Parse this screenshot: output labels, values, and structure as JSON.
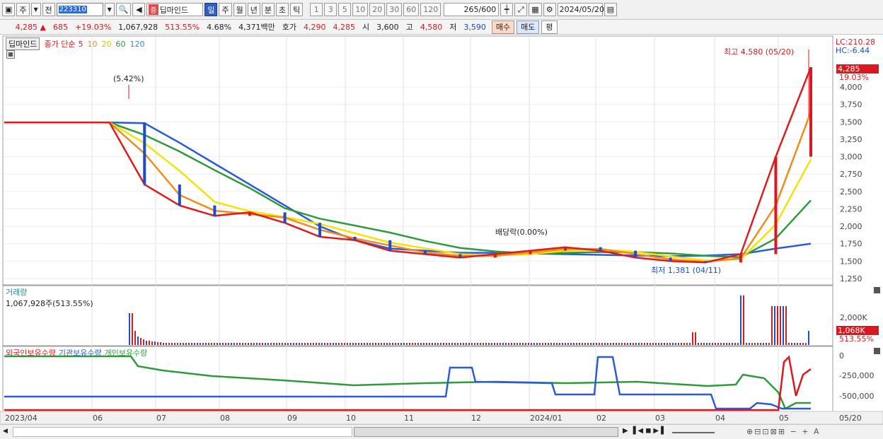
{
  "toolbar": {
    "market": "주",
    "prev": "전",
    "code": "223310",
    "tag": "증",
    "name": "딥마인드",
    "periods": [
      "일",
      "주",
      "월",
      "년",
      "분",
      "초",
      "틱"
    ],
    "numbers": [
      "1",
      "3",
      "5",
      "10",
      "20",
      "30",
      "60",
      "120"
    ],
    "count": "265/600",
    "date": "2024/05/20"
  },
  "quote": {
    "price": "4,285 ▲",
    "change": "685",
    "rate": "+19.03%",
    "volume": "1,067,928",
    "volume_rate": "513.55%",
    "turnover": "4.68%",
    "amount": "4,371백만",
    "ask_label": "호가",
    "ask1": "4,290",
    "ask2": "4,285",
    "open_label": "시",
    "open": "3,600",
    "high_label": "고",
    "high": "4,580",
    "low_label": "저",
    "low": "3,590",
    "buy": "매수",
    "sell": "매도",
    "avg": "평"
  },
  "price_panel": {
    "name_box": "딥마인드",
    "legend_prefix": "종가 단순",
    "ma_periods": [
      "5",
      "10",
      "20",
      "60",
      "120"
    ],
    "ma_colors": [
      "#e01b1b",
      "#f08c1a",
      "#f5e10a",
      "#2e9a3c",
      "#2b5bd8"
    ],
    "y_ticks": [
      "4,000",
      "3,750",
      "3,500",
      "3,250",
      "3,000",
      "2,750",
      "2,500",
      "2,250",
      "2,000",
      "1,750",
      "1,500",
      "1,250"
    ],
    "lc": "LC:210.28",
    "hc": "HC:-6.44",
    "current_price_tag": "4,285",
    "current_rate": "19.03%",
    "high_note": "최고 4,580 (05/20)",
    "low_note": "최저 1,381 (04/11)",
    "pct_note": "(5.42%)",
    "div_note": "배당락(0.00%)"
  },
  "volume_panel": {
    "title": "거래량",
    "value": "1,067,928주(513.55%)",
    "tick": "2,000K",
    "tag": "1,068K",
    "rate": "513.55%"
  },
  "holding_panel": {
    "series": [
      "외국인보유수량",
      "기관보유수량",
      "개인보유수량"
    ],
    "colors": [
      "#d9191f",
      "#2b5bd8",
      "#2e9a3c"
    ],
    "ticks": [
      "0",
      "-250,000",
      "-500,000"
    ]
  },
  "x_labels": [
    "2023/04",
    "06",
    "07",
    "08",
    "09",
    "10",
    "11",
    "12",
    "2024/01",
    "02",
    "03",
    "04",
    "05",
    "05/20"
  ],
  "chart_data": {
    "type": "line",
    "title": "",
    "y_range": [
      1250,
      4600
    ],
    "close_approx": [
      3490,
      3490,
      3490,
      3490,
      2600,
      2300,
      2150,
      2200,
      2050,
      1850,
      1800,
      1650,
      1600,
      1550,
      1600,
      1650,
      1700,
      1650,
      1550,
      1500,
      1480,
      1600,
      3000,
      4285
    ],
    "ma120_approx": [
      3490,
      3490,
      3490,
      3490,
      3480,
      3200,
      2900,
      2600,
      2300,
      2000,
      1800,
      1680,
      1650,
      1620,
      1620,
      1610,
      1600,
      1590,
      1580,
      1570,
      1580,
      1600,
      1680,
      1750
    ]
  }
}
